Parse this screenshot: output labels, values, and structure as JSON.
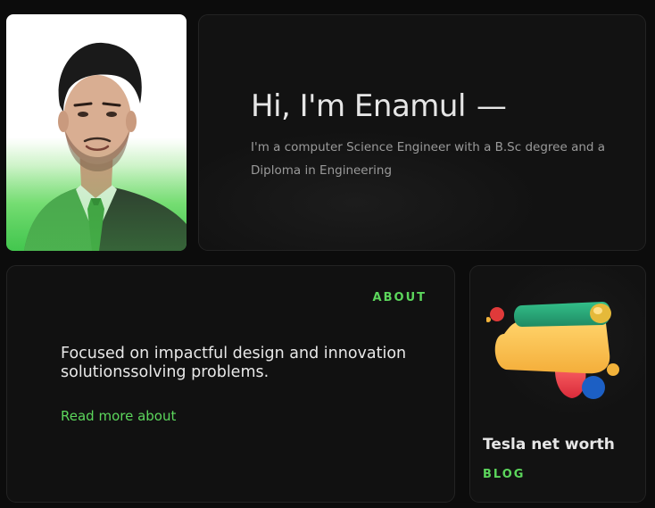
{
  "hero": {
    "title": "Hi, I'm Enamul",
    "dash": "—",
    "description": "I'm a computer Science Engineer with a B.Sc degree and a Diploma in Engineering"
  },
  "about": {
    "label": "ABOUT",
    "text": "Focused on impactful design and innovation solutionssolving problems.",
    "link": "Read more about"
  },
  "blog": {
    "title": "Tesla net worth",
    "label": "BLOG"
  },
  "colors": {
    "accent": "#5cd65c",
    "background": "#0c0c0c",
    "card": "#121212",
    "text_primary": "#e6e6e6",
    "text_secondary": "#9a9a9a"
  }
}
